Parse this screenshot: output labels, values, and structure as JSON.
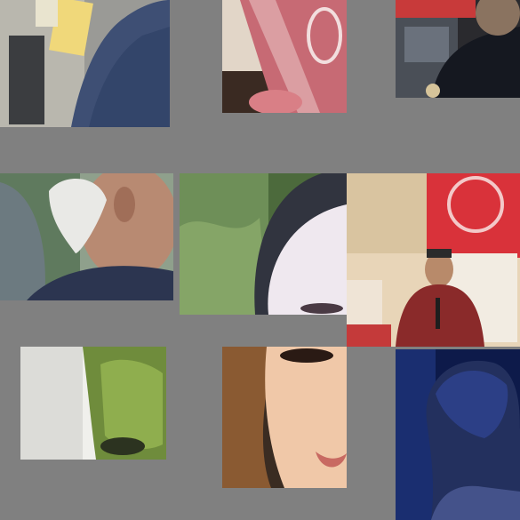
{
  "collage": {
    "background": "#808080",
    "tiles": [
      {
        "subject": "person-back-blue-shirt"
      },
      {
        "subject": "red-drink-glass"
      },
      {
        "subject": "police-officer-shoulder"
      },
      {
        "subject": "elderly-man-white-hair"
      },
      {
        "subject": "child-face-closeup"
      },
      {
        "subject": "man-singing-microphone"
      },
      {
        "subject": "ivy-wall"
      },
      {
        "subject": "smiling-girl"
      },
      {
        "subject": "person-blue-light"
      }
    ]
  }
}
